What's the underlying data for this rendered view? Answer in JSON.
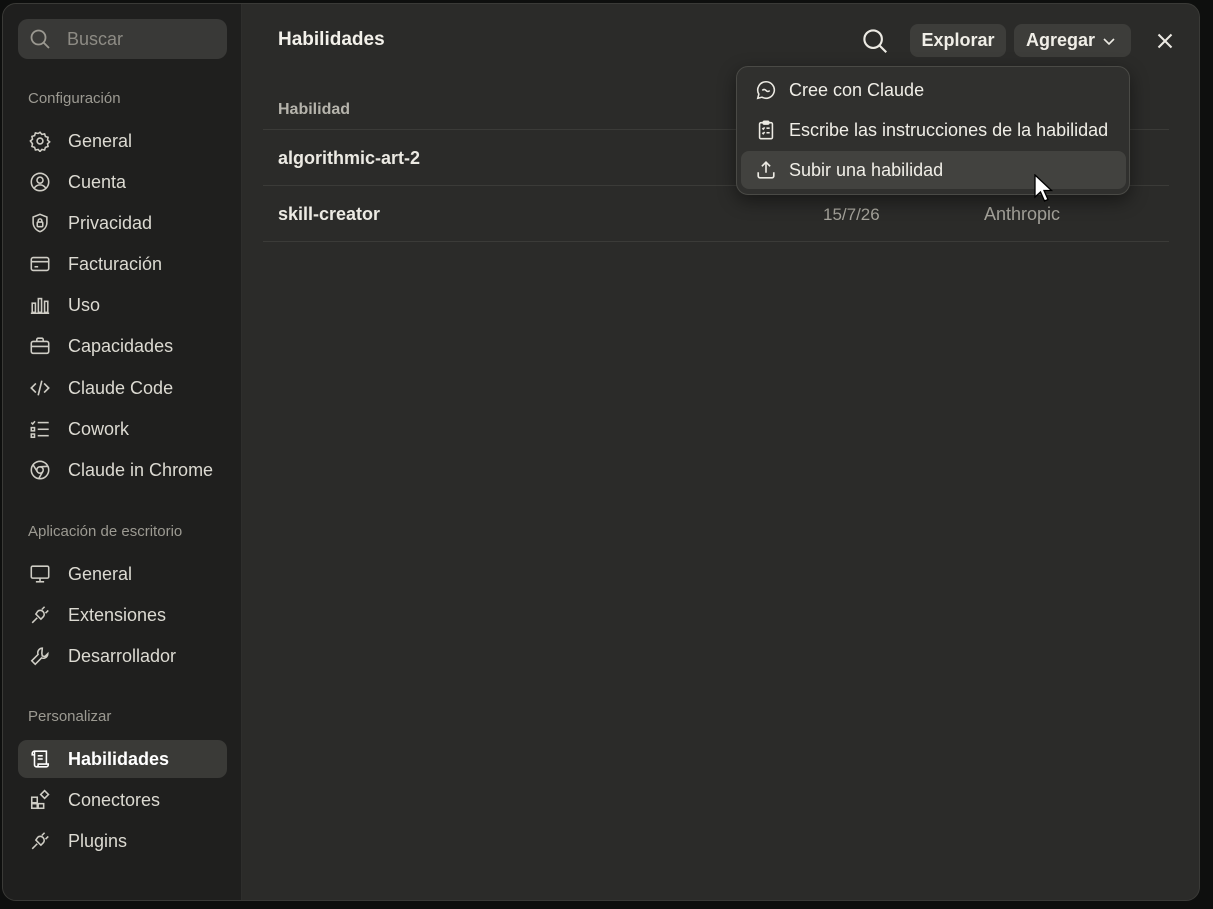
{
  "sidebar": {
    "search_placeholder": "Buscar",
    "sections": [
      {
        "label": "Configuración",
        "items": [
          {
            "label": "General",
            "icon": "gear-icon"
          },
          {
            "label": "Cuenta",
            "icon": "user-circle-icon"
          },
          {
            "label": "Privacidad",
            "icon": "shield-lock-icon"
          },
          {
            "label": "Facturación",
            "icon": "credit-card-icon"
          },
          {
            "label": "Uso",
            "icon": "bar-chart-icon"
          },
          {
            "label": "Capacidades",
            "icon": "briefcase-icon"
          },
          {
            "label": "Claude Code",
            "icon": "code-icon"
          },
          {
            "label": "Cowork",
            "icon": "checklist-icon"
          },
          {
            "label": "Claude in Chrome",
            "icon": "globe-icon"
          }
        ]
      },
      {
        "label": "Aplicación de escritorio",
        "items": [
          {
            "label": "General",
            "icon": "monitor-icon"
          },
          {
            "label": "Extensiones",
            "icon": "plug-icon"
          },
          {
            "label": "Desarrollador",
            "icon": "wrench-icon"
          }
        ]
      },
      {
        "label": "Personalizar",
        "items": [
          {
            "label": "Habilidades",
            "icon": "scroll-icon",
            "active": true
          },
          {
            "label": "Conectores",
            "icon": "connectors-icon"
          },
          {
            "label": "Plugins",
            "icon": "plug-icon"
          }
        ]
      }
    ]
  },
  "header": {
    "title": "Habilidades",
    "explore_label": "Explorar",
    "add_label": "Agregar"
  },
  "table": {
    "column_skill": "Habilidad",
    "rows": [
      {
        "name": "algorithmic-art-2",
        "date": "",
        "author": ""
      },
      {
        "name": "skill-creator",
        "date": "15/7/26",
        "author": "Anthropic"
      }
    ]
  },
  "add_menu": {
    "items": [
      {
        "label": "Cree con Claude",
        "icon": "chat-bubble-icon"
      },
      {
        "label": "Escribe las instrucciones de la habilidad",
        "icon": "clipboard-icon"
      },
      {
        "label": "Subir una habilidad",
        "icon": "upload-icon",
        "hovered": true
      }
    ]
  }
}
